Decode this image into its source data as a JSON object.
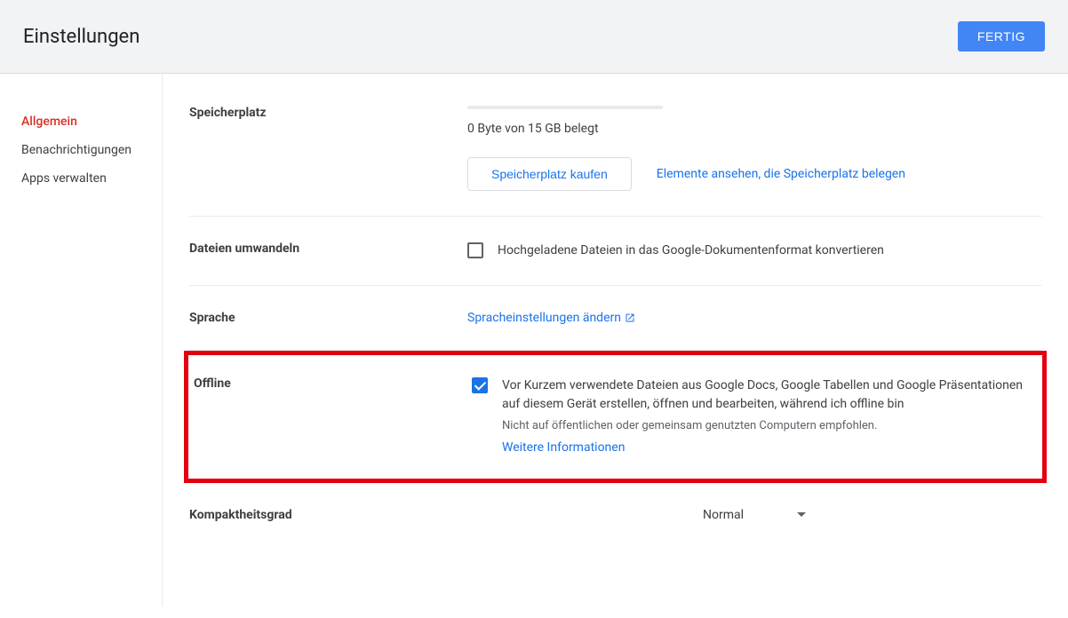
{
  "header": {
    "title": "Einstellungen",
    "done": "FERTIG"
  },
  "sidebar": {
    "items": [
      {
        "label": "Allgemein",
        "active": true
      },
      {
        "label": "Benachrichtigungen",
        "active": false
      },
      {
        "label": "Apps verwalten",
        "active": false
      }
    ]
  },
  "storage": {
    "label": "Speicherplatz",
    "usage": "0 Byte von 15 GB belegt",
    "buy": "Speicherplatz kaufen",
    "view": "Elemente ansehen, die Speicherplatz belegen"
  },
  "convert": {
    "label": "Dateien umwandeln",
    "text": "Hochgeladene Dateien in das Google-Dokumentenformat konvertieren"
  },
  "language": {
    "label": "Sprache",
    "link": "Spracheinstellungen ändern"
  },
  "offline": {
    "label": "Offline",
    "text": "Vor Kurzem verwendete Dateien aus Google Docs, Google Tabellen und Google Präsentationen auf diesem Gerät erstellen, öffnen und bearbeiten, während ich offline bin",
    "sub": "Nicht auf öffentlichen oder gemeinsam genutzten Computern empfohlen.",
    "more": "Weitere Informationen"
  },
  "density": {
    "label": "Kompaktheitsgrad",
    "value": "Normal"
  }
}
